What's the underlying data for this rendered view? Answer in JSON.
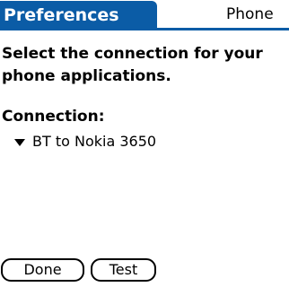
{
  "header": {
    "title": "Preferences",
    "section": "Phone"
  },
  "instruction": "Select the connection for your\nphone applications.",
  "connection": {
    "label": "Connection:",
    "selected": "BT to Nokia 3650"
  },
  "buttons": {
    "done": "Done",
    "test": "Test"
  },
  "colors": {
    "titlebar": "#0b5ca6"
  }
}
